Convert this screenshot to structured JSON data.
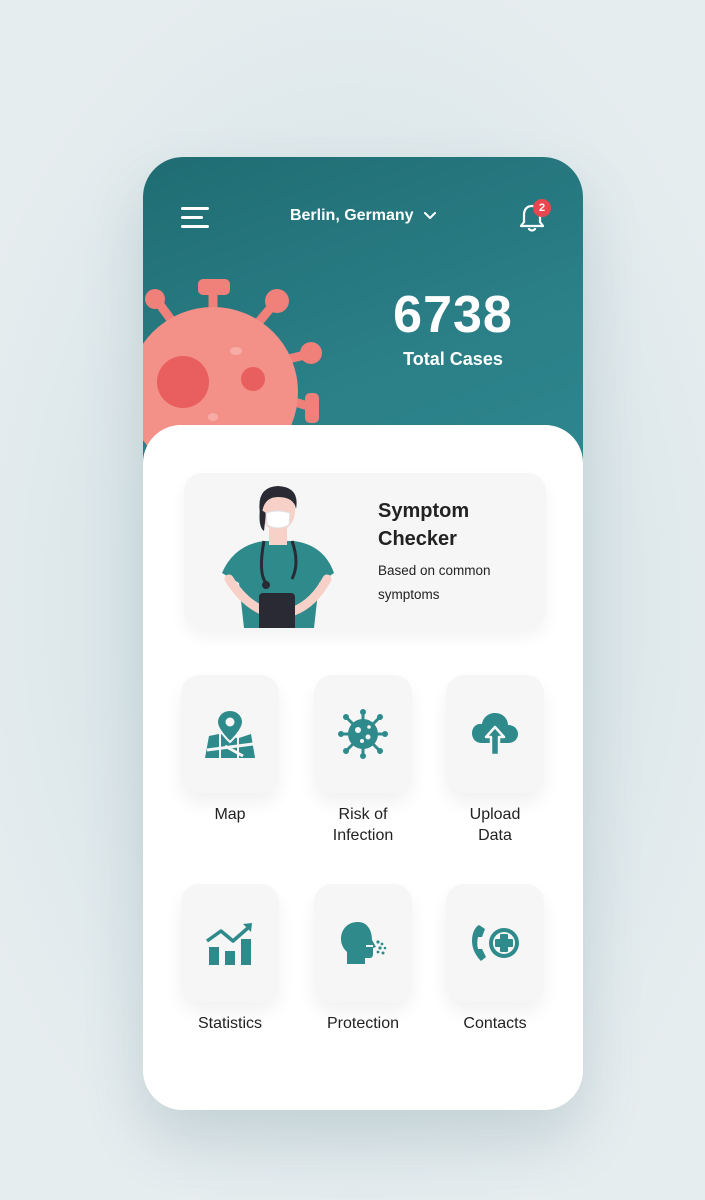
{
  "header": {
    "location": "Berlin, Germany",
    "notification_count": "2",
    "total_cases": "6738",
    "total_cases_label": "Total Cases"
  },
  "symptom_card": {
    "title": "Symptom Checker",
    "subtitle": "Based on common symptoms"
  },
  "tiles": [
    {
      "label": "Map",
      "icon": "map-pin-icon"
    },
    {
      "label": "Risk of Infection",
      "icon": "virus-icon"
    },
    {
      "label": "Upload Data",
      "icon": "cloud-upload-icon"
    },
    {
      "label": "Statistics",
      "icon": "chart-growth-icon"
    },
    {
      "label": "Protection",
      "icon": "sneeze-head-icon"
    },
    {
      "label": "Contacts",
      "icon": "phone-medical-icon"
    }
  ],
  "colors": {
    "primary_teal": "#2b7f87",
    "virus_coral": "#f0807a",
    "badge_red": "#e8474f",
    "tile_bg": "#f6f6f6"
  }
}
